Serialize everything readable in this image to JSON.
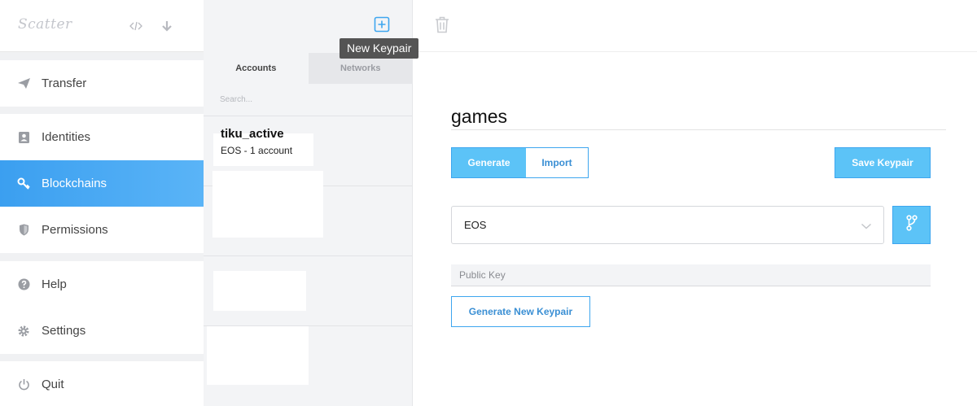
{
  "app": {
    "logo_text": "Scatter"
  },
  "header": {
    "icons": [
      "code-icon",
      "download-icon"
    ],
    "add_keypair_tooltip": "New Keypair"
  },
  "sidebar": {
    "items": [
      {
        "label": "Transfer",
        "icon": "paper-plane-icon"
      },
      {
        "label": "Identities",
        "icon": "id-card-icon"
      },
      {
        "label": "Blockchains",
        "icon": "key-icon",
        "active": true
      },
      {
        "label": "Permissions",
        "icon": "shield-icon"
      },
      {
        "label": "Help",
        "icon": "question-icon"
      },
      {
        "label": "Settings",
        "icon": "gear-icon"
      },
      {
        "label": "Quit",
        "icon": "power-icon"
      }
    ]
  },
  "list": {
    "tabs": [
      {
        "label": "Accounts",
        "active": true
      },
      {
        "label": "Networks",
        "active": false
      }
    ],
    "search_placeholder": "Search...",
    "accounts": [
      {
        "name": "tiku_active",
        "subtitle": "EOS - 1 account"
      }
    ]
  },
  "editor": {
    "keypair_name": "games",
    "mode_buttons": {
      "generate": "Generate",
      "import": "Import"
    },
    "save_label": "Save Keypair",
    "blockchain_select": "EOS",
    "public_key_label": "Public Key",
    "generate_new_label": "Generate New Keypair"
  },
  "colors": {
    "accent": "#5cc3f7",
    "accent_border": "#3ea6ef",
    "sidebar_active": "#4aaaf4",
    "tooltip_bg": "#545454"
  }
}
